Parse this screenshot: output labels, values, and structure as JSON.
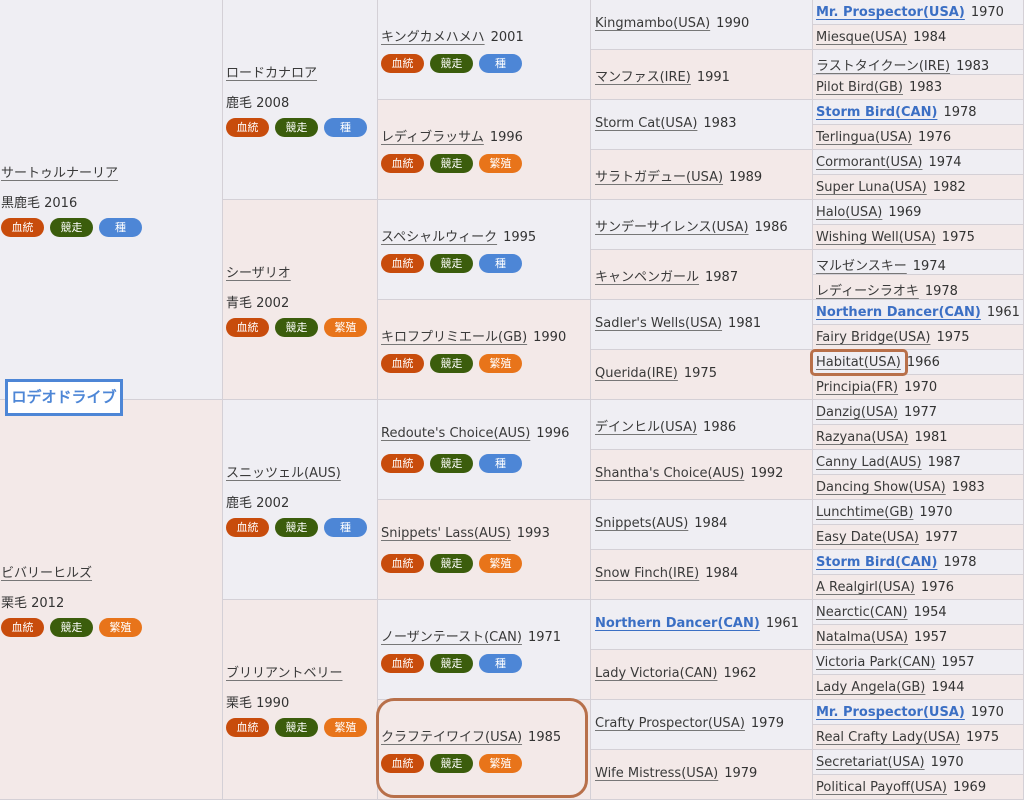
{
  "title": "ロデオドライブ",
  "tags": {
    "blood": "血統",
    "race": "競走",
    "stud": "種",
    "breed": "繁殖"
  },
  "gen1": [
    {
      "name": "サートゥルナーリア",
      "coat": "黒鹿毛 2016"
    },
    {
      "name": "ビバリーヒルズ",
      "coat": "栗毛 2012"
    }
  ],
  "gen2": [
    {
      "name": "ロードカナロア",
      "coat": "鹿毛 2008"
    },
    {
      "name": "シーザリオ",
      "coat": "青毛 2002"
    },
    {
      "name": "スニッツェル(AUS)",
      "coat": "鹿毛 2002"
    },
    {
      "name": "ブリリアントベリー",
      "coat": "栗毛 1990"
    }
  ],
  "gen3": [
    {
      "name": "キングカメハメハ",
      "year": "2001"
    },
    {
      "name": "レディブラッサム",
      "year": "1996"
    },
    {
      "name": "スペシャルウィーク",
      "year": "1995"
    },
    {
      "name": "キロフプリミエール(GB)",
      "year": "1990"
    },
    {
      "name": "Redoute's Choice(AUS)",
      "year": "1996"
    },
    {
      "name": "Snippets' Lass(AUS)",
      "year": "1993"
    },
    {
      "name": "ノーザンテースト(CAN)",
      "year": "1971"
    },
    {
      "name": "クラフテイワイフ(USA)",
      "year": "1985"
    }
  ],
  "gen4": [
    {
      "name": "Kingmambo(USA)",
      "year": "1990"
    },
    {
      "name": "マンファス(IRE)",
      "year": "1991"
    },
    {
      "name": "Storm Cat(USA)",
      "year": "1983"
    },
    {
      "name": "サラトガデュー(USA)",
      "year": "1989"
    },
    {
      "name": "サンデーサイレンス(USA)",
      "year": "1986"
    },
    {
      "name": "キャンペンガール",
      "year": "1987"
    },
    {
      "name": "Sadler's Wells(USA)",
      "year": "1981"
    },
    {
      "name": "Querida(IRE)",
      "year": "1975"
    },
    {
      "name": "デインヒル(USA)",
      "year": "1986"
    },
    {
      "name": "Shantha's Choice(AUS)",
      "year": "1992"
    },
    {
      "name": "Snippets(AUS)",
      "year": "1984"
    },
    {
      "name": "Snow Finch(IRE)",
      "year": "1984"
    },
    {
      "name": "Northern Dancer(CAN)",
      "year": "1961"
    },
    {
      "name": "Lady Victoria(CAN)",
      "year": "1962"
    },
    {
      "name": "Crafty Prospector(USA)",
      "year": "1979"
    },
    {
      "name": "Wife Mistress(USA)",
      "year": "1979"
    }
  ],
  "gen5": [
    {
      "name": "Mr. Prospector(USA)",
      "year": "1970"
    },
    {
      "name": "Miesque(USA)",
      "year": "1984"
    },
    {
      "name": "ラストタイクーン(IRE)",
      "year": "1983"
    },
    {
      "name": "Pilot Bird(GB)",
      "year": "1983"
    },
    {
      "name": "Storm Bird(CAN)",
      "year": "1978"
    },
    {
      "name": "Terlingua(USA)",
      "year": "1976"
    },
    {
      "name": "Cormorant(USA)",
      "year": "1974"
    },
    {
      "name": "Super Luna(USA)",
      "year": "1982"
    },
    {
      "name": "Halo(USA)",
      "year": "1969"
    },
    {
      "name": "Wishing Well(USA)",
      "year": "1975"
    },
    {
      "name": "マルゼンスキー",
      "year": "1974"
    },
    {
      "name": "レディーシラオキ",
      "year": "1978"
    },
    {
      "name": "Northern Dancer(CAN)",
      "year": "1961"
    },
    {
      "name": "Fairy Bridge(USA)",
      "year": "1975"
    },
    {
      "name": "Habitat(USA)",
      "year": "1966"
    },
    {
      "name": "Principia(FR)",
      "year": "1970"
    },
    {
      "name": "Danzig(USA)",
      "year": "1977"
    },
    {
      "name": "Razyana(USA)",
      "year": "1981"
    },
    {
      "name": "Canny Lad(AUS)",
      "year": "1987"
    },
    {
      "name": "Dancing Show(USA)",
      "year": "1983"
    },
    {
      "name": "Lunchtime(GB)",
      "year": "1970"
    },
    {
      "name": "Easy Date(USA)",
      "year": "1977"
    },
    {
      "name": "Storm Bird(CAN)",
      "year": "1978"
    },
    {
      "name": "A Realgirl(USA)",
      "year": "1976"
    },
    {
      "name": "Nearctic(CAN)",
      "year": "1954"
    },
    {
      "name": "Natalma(USA)",
      "year": "1957"
    },
    {
      "name": "Victoria Park(CAN)",
      "year": "1957"
    },
    {
      "name": "Lady Angela(GB)",
      "year": "1944"
    },
    {
      "name": "Mr. Prospector(USA)",
      "year": "1970"
    },
    {
      "name": "Real Crafty Lady(USA)",
      "year": "1975"
    },
    {
      "name": "Secretariat(USA)",
      "year": "1970"
    },
    {
      "name": "Political Payoff(USA)",
      "year": "1969"
    }
  ]
}
